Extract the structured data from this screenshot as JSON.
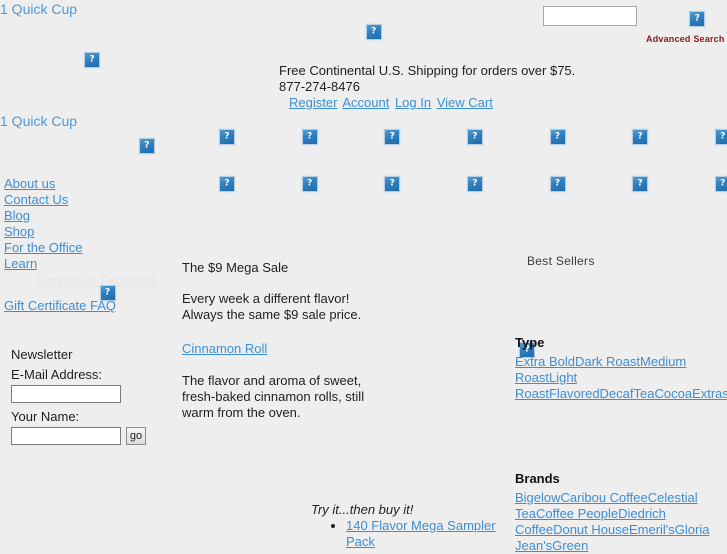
{
  "site": {
    "logo_top": "1 Quick Cup",
    "logo_secondary": "1 Quick Cup"
  },
  "header": {
    "search_value": "",
    "search_placeholder": "",
    "search_button_icon": "search-button-image",
    "advanced_search": "Advanced Search",
    "shipping_notice": "Free Continental U.S. Shipping for orders over $75.",
    "phone": "877-274-8476",
    "account_links": [
      {
        "label": "Register"
      },
      {
        "label": "Account"
      },
      {
        "label": "Log In"
      },
      {
        "label": "View Cart"
      }
    ],
    "cart_icon": "cart-image"
  },
  "nav": {
    "row1_icons": [
      "nav-image-1",
      "nav-image-2",
      "nav-image-3",
      "nav-image-4",
      "nav-image-5",
      "nav-image-6",
      "nav-image-7",
      "nav-image-8"
    ],
    "row2_icons": [
      "nav-image-9",
      "nav-image-10",
      "nav-image-11",
      "nav-image-12",
      "nav-image-13",
      "nav-image-14",
      "nav-image-15",
      "nav-image-16"
    ]
  },
  "sidebar": {
    "links": [
      {
        "label": "About us"
      },
      {
        "label": "Contact Us"
      },
      {
        "label": "Blog"
      },
      {
        "label": "Shop"
      },
      {
        "label": "For the Office"
      },
      {
        "label": "Learn"
      }
    ],
    "facebook_label": "Find us on Facebook",
    "facebook_icon": "facebook-image",
    "gift_certificate": "Gift Certificate FAQ",
    "newsletter": {
      "title": "Newsletter",
      "email_label": "E-Mail Address:",
      "email_value": "",
      "name_label": "Your Name:",
      "name_value": "",
      "submit_label": "go"
    }
  },
  "main": {
    "heading": "The $9 Mega Sale",
    "line1": "Every week a different flavor!",
    "line2": "Always the same $9 sale price.",
    "flavor_link": "Cinnamon Roll ",
    "flavor_image_icon": "cinnamon-roll-image",
    "description_line1": "The flavor and aroma of sweet,",
    "description_line2": "fresh-baked cinnamon rolls, still",
    "description_line3": "warm from the oven.",
    "try_it": "Try it...then buy it!",
    "sampler_items": [
      {
        "label": "140 Flavor Mega Sampler Pack"
      }
    ]
  },
  "right": {
    "best_sellers": "Best Sellers",
    "type_title": "Type",
    "type_links": [
      {
        "label": "Extra Bold"
      },
      {
        "label": "Dark Roast"
      },
      {
        "label": "Medium Roast"
      },
      {
        "label": "Light Roast"
      },
      {
        "label": "Flavored"
      },
      {
        "label": "Decaf"
      },
      {
        "label": "Tea"
      },
      {
        "label": "Cocoa"
      },
      {
        "label": "Extras"
      }
    ],
    "brands_title": "Brands",
    "brand_links": [
      {
        "label": "Bigelow"
      },
      {
        "label": "Caribou Coffee"
      },
      {
        "label": "Celestial Tea"
      },
      {
        "label": "Coffee People"
      },
      {
        "label": "Diedrich Coffee"
      },
      {
        "label": "Donut House"
      },
      {
        "label": "Emeril's"
      },
      {
        "label": "Gloria Jean's"
      },
      {
        "label": "Green"
      }
    ]
  },
  "colors": {
    "page_background": "#eeeeee",
    "link": "#3c8fd4",
    "logo": "#4a9ad8",
    "advanced_search": "#8b1a1a",
    "broken_image": "#2f7fc0"
  }
}
